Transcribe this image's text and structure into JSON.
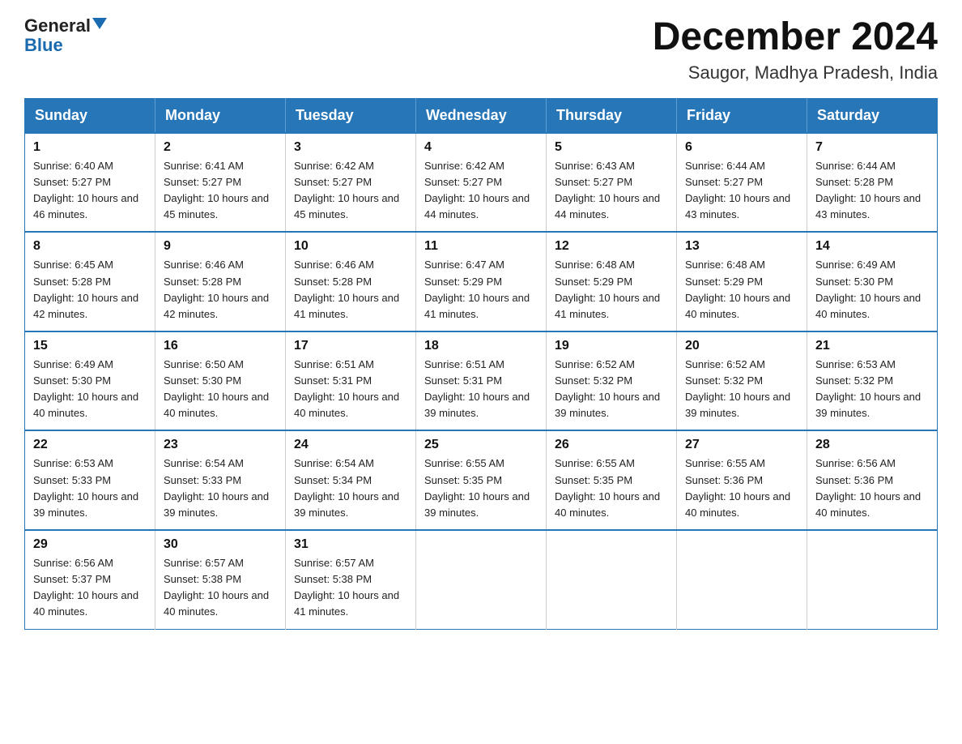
{
  "logo": {
    "general": "General",
    "blue": "Blue"
  },
  "header": {
    "title": "December 2024",
    "subtitle": "Saugor, Madhya Pradesh, India"
  },
  "days_of_week": [
    "Sunday",
    "Monday",
    "Tuesday",
    "Wednesday",
    "Thursday",
    "Friday",
    "Saturday"
  ],
  "weeks": [
    [
      {
        "day": "1",
        "sunrise": "6:40 AM",
        "sunset": "5:27 PM",
        "daylight": "10 hours and 46 minutes."
      },
      {
        "day": "2",
        "sunrise": "6:41 AM",
        "sunset": "5:27 PM",
        "daylight": "10 hours and 45 minutes."
      },
      {
        "day": "3",
        "sunrise": "6:42 AM",
        "sunset": "5:27 PM",
        "daylight": "10 hours and 45 minutes."
      },
      {
        "day": "4",
        "sunrise": "6:42 AM",
        "sunset": "5:27 PM",
        "daylight": "10 hours and 44 minutes."
      },
      {
        "day": "5",
        "sunrise": "6:43 AM",
        "sunset": "5:27 PM",
        "daylight": "10 hours and 44 minutes."
      },
      {
        "day": "6",
        "sunrise": "6:44 AM",
        "sunset": "5:27 PM",
        "daylight": "10 hours and 43 minutes."
      },
      {
        "day": "7",
        "sunrise": "6:44 AM",
        "sunset": "5:28 PM",
        "daylight": "10 hours and 43 minutes."
      }
    ],
    [
      {
        "day": "8",
        "sunrise": "6:45 AM",
        "sunset": "5:28 PM",
        "daylight": "10 hours and 42 minutes."
      },
      {
        "day": "9",
        "sunrise": "6:46 AM",
        "sunset": "5:28 PM",
        "daylight": "10 hours and 42 minutes."
      },
      {
        "day": "10",
        "sunrise": "6:46 AM",
        "sunset": "5:28 PM",
        "daylight": "10 hours and 41 minutes."
      },
      {
        "day": "11",
        "sunrise": "6:47 AM",
        "sunset": "5:29 PM",
        "daylight": "10 hours and 41 minutes."
      },
      {
        "day": "12",
        "sunrise": "6:48 AM",
        "sunset": "5:29 PM",
        "daylight": "10 hours and 41 minutes."
      },
      {
        "day": "13",
        "sunrise": "6:48 AM",
        "sunset": "5:29 PM",
        "daylight": "10 hours and 40 minutes."
      },
      {
        "day": "14",
        "sunrise": "6:49 AM",
        "sunset": "5:30 PM",
        "daylight": "10 hours and 40 minutes."
      }
    ],
    [
      {
        "day": "15",
        "sunrise": "6:49 AM",
        "sunset": "5:30 PM",
        "daylight": "10 hours and 40 minutes."
      },
      {
        "day": "16",
        "sunrise": "6:50 AM",
        "sunset": "5:30 PM",
        "daylight": "10 hours and 40 minutes."
      },
      {
        "day": "17",
        "sunrise": "6:51 AM",
        "sunset": "5:31 PM",
        "daylight": "10 hours and 40 minutes."
      },
      {
        "day": "18",
        "sunrise": "6:51 AM",
        "sunset": "5:31 PM",
        "daylight": "10 hours and 39 minutes."
      },
      {
        "day": "19",
        "sunrise": "6:52 AM",
        "sunset": "5:32 PM",
        "daylight": "10 hours and 39 minutes."
      },
      {
        "day": "20",
        "sunrise": "6:52 AM",
        "sunset": "5:32 PM",
        "daylight": "10 hours and 39 minutes."
      },
      {
        "day": "21",
        "sunrise": "6:53 AM",
        "sunset": "5:32 PM",
        "daylight": "10 hours and 39 minutes."
      }
    ],
    [
      {
        "day": "22",
        "sunrise": "6:53 AM",
        "sunset": "5:33 PM",
        "daylight": "10 hours and 39 minutes."
      },
      {
        "day": "23",
        "sunrise": "6:54 AM",
        "sunset": "5:33 PM",
        "daylight": "10 hours and 39 minutes."
      },
      {
        "day": "24",
        "sunrise": "6:54 AM",
        "sunset": "5:34 PM",
        "daylight": "10 hours and 39 minutes."
      },
      {
        "day": "25",
        "sunrise": "6:55 AM",
        "sunset": "5:35 PM",
        "daylight": "10 hours and 39 minutes."
      },
      {
        "day": "26",
        "sunrise": "6:55 AM",
        "sunset": "5:35 PM",
        "daylight": "10 hours and 40 minutes."
      },
      {
        "day": "27",
        "sunrise": "6:55 AM",
        "sunset": "5:36 PM",
        "daylight": "10 hours and 40 minutes."
      },
      {
        "day": "28",
        "sunrise": "6:56 AM",
        "sunset": "5:36 PM",
        "daylight": "10 hours and 40 minutes."
      }
    ],
    [
      {
        "day": "29",
        "sunrise": "6:56 AM",
        "sunset": "5:37 PM",
        "daylight": "10 hours and 40 minutes."
      },
      {
        "day": "30",
        "sunrise": "6:57 AM",
        "sunset": "5:38 PM",
        "daylight": "10 hours and 40 minutes."
      },
      {
        "day": "31",
        "sunrise": "6:57 AM",
        "sunset": "5:38 PM",
        "daylight": "10 hours and 41 minutes."
      },
      null,
      null,
      null,
      null
    ]
  ]
}
